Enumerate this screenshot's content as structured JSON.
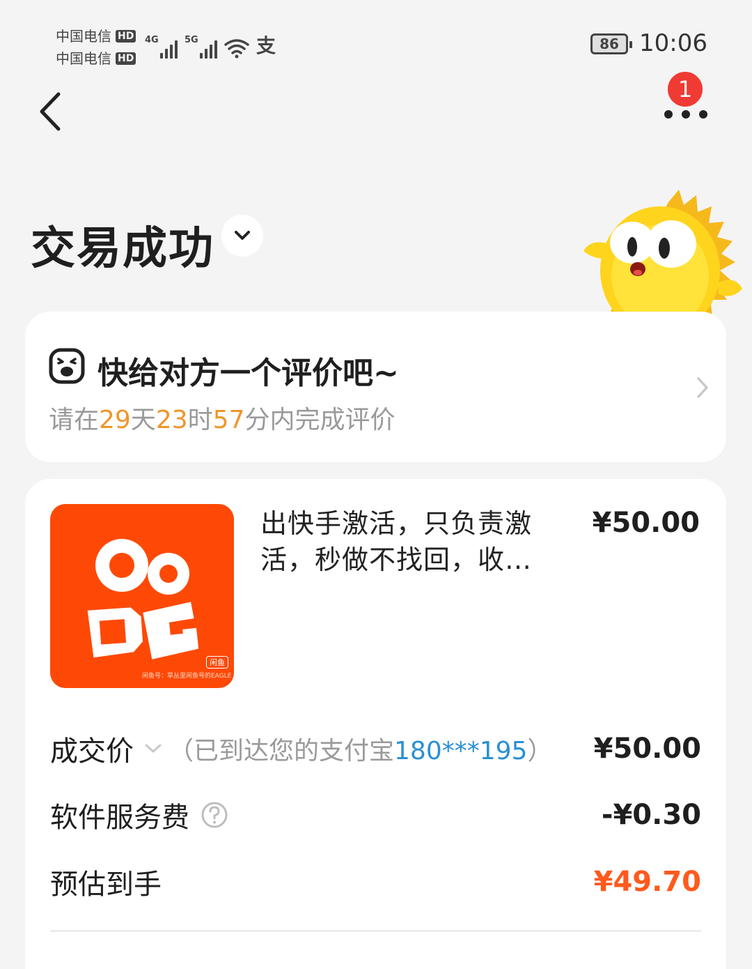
{
  "status_bar": {
    "carrier_1": "中国电信",
    "carrier_2": "中国电信",
    "hd_badge": "HD",
    "network_1": "4G",
    "network_2": "5G",
    "alipay_glyph": "支",
    "battery": "86",
    "time": "10:06"
  },
  "nav": {
    "notification_count": "1"
  },
  "header": {
    "title": "交易成功"
  },
  "review": {
    "title": "快给对方一个评价吧~",
    "sub_prefix": "请在",
    "days": "29",
    "days_unit": "天",
    "hours": "23",
    "hours_unit": "时",
    "minutes": "57",
    "sub_suffix": "分内完成评价"
  },
  "item": {
    "title": "出快手激活，只负责激活，秒做不找回，收…",
    "price": "¥50.00",
    "thumb_tag": "闲鱼",
    "thumb_watermark": "闲鱼号：草丛里闲鱼号的EAGLE"
  },
  "summary": {
    "deal_price_label": "成交价",
    "deal_note_prefix": "（已到达您的支付宝",
    "deal_note_account": "180***195",
    "deal_note_suffix": "）",
    "deal_price_value": "¥50.00",
    "service_fee_label": "软件服务费",
    "service_fee_value": "-¥0.30",
    "estimated_label": "预估到手",
    "estimated_value": "¥49.70"
  },
  "colors": {
    "accent_orange": "#fe5a1d",
    "countdown": "#f0952a",
    "account_blue": "#2a8fd6",
    "badge_red": "#ef3b33",
    "thumb_bg": "#fe4906"
  }
}
